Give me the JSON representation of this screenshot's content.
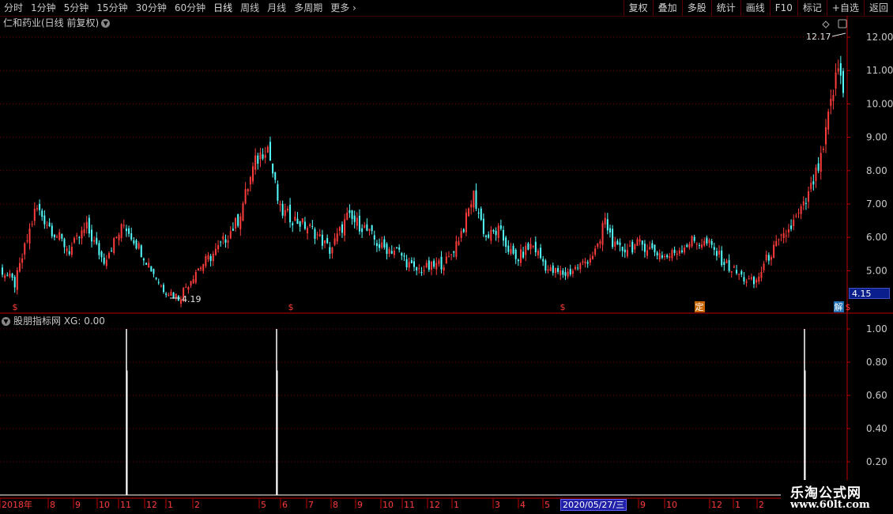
{
  "toolbar": {
    "periods": [
      "分时",
      "1分钟",
      "5分钟",
      "15分钟",
      "30分钟",
      "60分钟",
      "日线",
      "周线",
      "月线",
      "多周期",
      "更多"
    ],
    "active_period": "日线",
    "buttons": [
      "复权",
      "叠加",
      "多股",
      "统计",
      "画线",
      "F10",
      "标记",
      "+自选",
      "返回"
    ]
  },
  "stock_title": "仁和药业(日线 前复权)",
  "indicator_title": "股朋指标网 XG: 0.00",
  "price_axis": [
    "12.00",
    "11.00",
    "10.00",
    "9.00",
    "8.00",
    "7.00",
    "6.00",
    "5.00"
  ],
  "indicator_axis": [
    "1.00",
    "0.80",
    "0.60",
    "0.40",
    "0.20"
  ],
  "annotations": {
    "high_label": "12.17",
    "low_label": "4.19",
    "current_price": "4.15",
    "signal_s": "$",
    "signal_ding": "定",
    "signal_jie": "解"
  },
  "date_axis": [
    "2018年",
    "8",
    "9",
    "10",
    "11",
    "12",
    "1",
    "2",
    "5",
    "6",
    "7",
    "8",
    "9",
    "10",
    "11",
    "12",
    "1",
    "3",
    "4",
    "5",
    "9",
    "10",
    "12",
    "1",
    "2"
  ],
  "date_cursor": "2020/05/27/三",
  "watermark": {
    "line1": "乐淘公式网",
    "line2": "www.60lt.com"
  },
  "colors": {
    "up": "#ff3c3c",
    "down": "#54ffff",
    "grid": "#7a0000",
    "indicator_line": "#ffffff",
    "background": "#000000"
  },
  "chart_data": {
    "type": "candlestick",
    "ylim": [
      4.15,
      12.17
    ],
    "high": 12.17,
    "low": 4.19,
    "indicator": {
      "name": "XG",
      "ylim": [
        0,
        1
      ],
      "signals_at_dates": [
        "2018/11",
        "2019/05",
        "2021/02"
      ],
      "value": 0.0
    },
    "price_path": [
      [
        0.0,
        5.0
      ],
      [
        0.015,
        4.6
      ],
      [
        0.04,
        6.9
      ],
      [
        0.06,
        6.2
      ],
      [
        0.08,
        5.6
      ],
      [
        0.1,
        6.3
      ],
      [
        0.12,
        5.3
      ],
      [
        0.145,
        6.4
      ],
      [
        0.165,
        5.6
      ],
      [
        0.19,
        4.5
      ],
      [
        0.21,
        4.2
      ],
      [
        0.23,
        5.0
      ],
      [
        0.255,
        5.6
      ],
      [
        0.28,
        6.5
      ],
      [
        0.3,
        8.2
      ],
      [
        0.315,
        8.8
      ],
      [
        0.33,
        6.8
      ],
      [
        0.35,
        6.5
      ],
      [
        0.37,
        6.2
      ],
      [
        0.39,
        5.6
      ],
      [
        0.41,
        6.6
      ],
      [
        0.43,
        6.3
      ],
      [
        0.45,
        5.7
      ],
      [
        0.47,
        5.6
      ],
      [
        0.49,
        5.0
      ],
      [
        0.51,
        5.1
      ],
      [
        0.53,
        5.3
      ],
      [
        0.55,
        6.4
      ],
      [
        0.56,
        7.3
      ],
      [
        0.575,
        6.0
      ],
      [
        0.59,
        6.2
      ],
      [
        0.61,
        5.3
      ],
      [
        0.63,
        5.8
      ],
      [
        0.65,
        5.0
      ],
      [
        0.67,
        4.9
      ],
      [
        0.69,
        5.2
      ],
      [
        0.71,
        5.7
      ],
      [
        0.715,
        6.6
      ],
      [
        0.73,
        5.6
      ],
      [
        0.76,
        5.8
      ],
      [
        0.79,
        5.4
      ],
      [
        0.82,
        5.9
      ],
      [
        0.84,
        5.8
      ],
      [
        0.86,
        5.2
      ],
      [
        0.88,
        4.8
      ],
      [
        0.895,
        4.6
      ],
      [
        0.91,
        5.4
      ],
      [
        0.935,
        6.2
      ],
      [
        0.955,
        7.0
      ],
      [
        0.975,
        8.4
      ],
      [
        0.985,
        10.0
      ],
      [
        0.995,
        11.2
      ],
      [
        1.0,
        10.3
      ]
    ]
  }
}
